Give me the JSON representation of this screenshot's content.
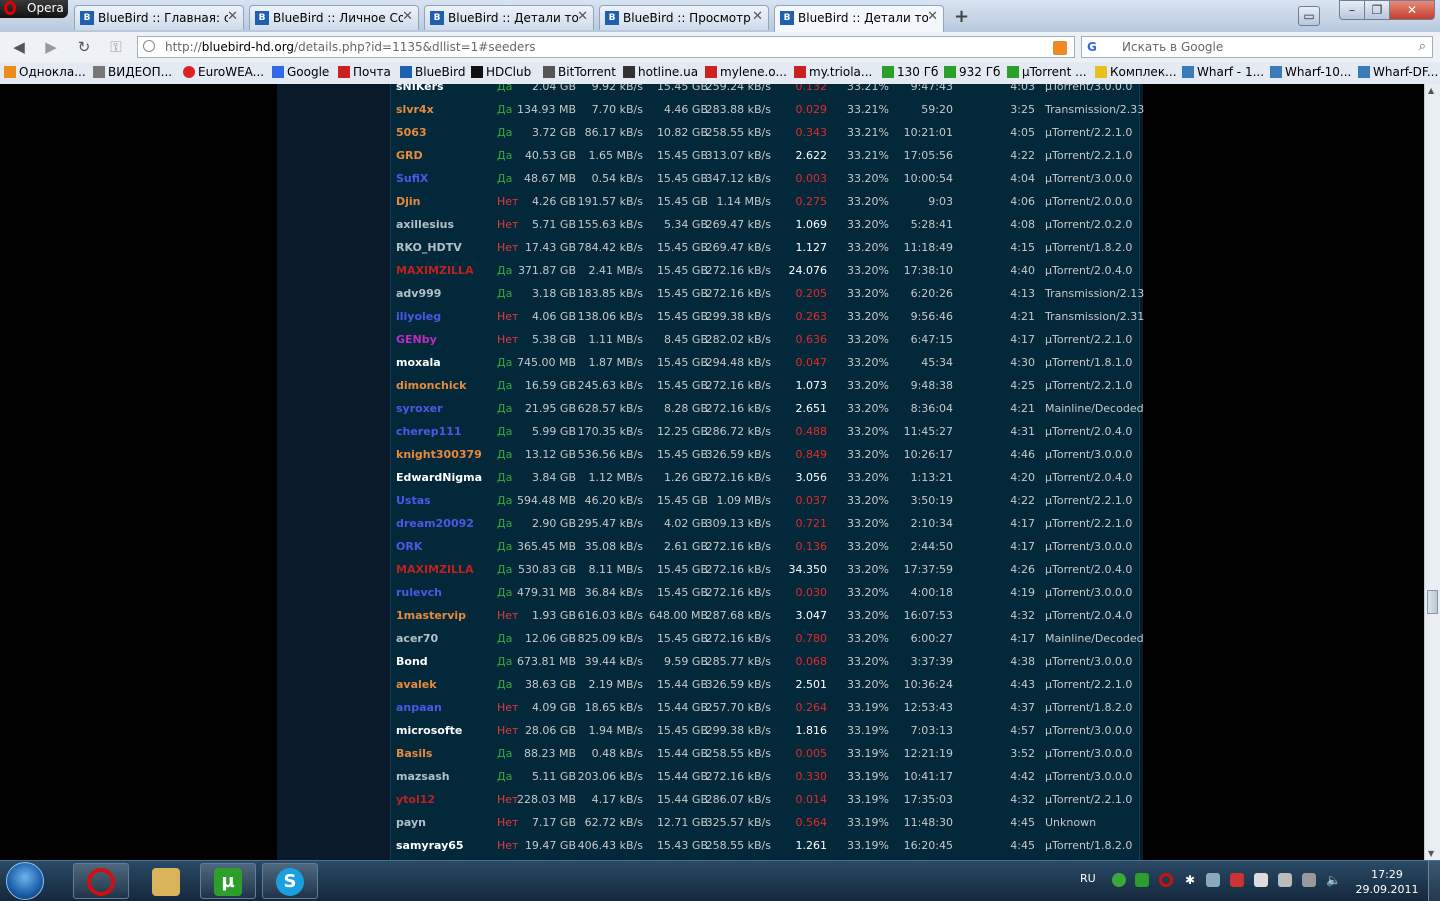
{
  "browser": {
    "menu_label": "Opera",
    "tabs": [
      {
        "title": "BlueBird :: Главная: ск..."
      },
      {
        "title": "BlueBird :: Личное Соо..."
      },
      {
        "title": "BlueBird :: Детали тор..."
      },
      {
        "title": "BlueBird :: Просмотр п..."
      },
      {
        "title": "BlueBird :: Детали тор..."
      }
    ],
    "new_tab": "+",
    "url_prefix": "http://",
    "url_host": "bluebird-hd.org",
    "url_path": "/details.php?id=1135&dllist=1#seeders",
    "search_placeholder": "Искать в Google",
    "search_engine": "G"
  },
  "bookmarks": [
    {
      "label": "Однокла..."
    },
    {
      "label": "ВИДЕОП..."
    },
    {
      "label": "EuroWEA..."
    },
    {
      "label": "Google"
    },
    {
      "label": "Почта"
    },
    {
      "label": "BlueBird"
    },
    {
      "label": "HDClub"
    },
    {
      "label": "BitTorrent"
    },
    {
      "label": "hotline.ua"
    },
    {
      "label": "mylene.o..."
    },
    {
      "label": "my.triola..."
    },
    {
      "label": "130 Гб"
    },
    {
      "label": "932 Гб"
    },
    {
      "label": "µTorrent ..."
    },
    {
      "label": "Комплек..."
    },
    {
      "label": "Wharf - 1..."
    },
    {
      "label": "Wharf-10..."
    },
    {
      "label": "Wharf-DF..."
    }
  ],
  "colors": {
    "page_bg": "#000000",
    "table_bg": "#02283a",
    "yes": "#3aa83a",
    "no": "#e23a3a",
    "ratio_good": "#ffffff",
    "ratio_bad": "#e22a2a",
    "user_orange": "#e88a3c",
    "user_blue": "#4d57e6",
    "user_white": "#ffffff",
    "user_gray": "#b4c0c8",
    "user_red": "#c0201e",
    "user_magenta": "#c02ac0"
  },
  "peers": [
    {
      "name": "sNIKers",
      "cls": "white",
      "conn": "Да",
      "up": "2.04 GB",
      "us": "9.92 kB/s",
      "dl": "15.45 GB",
      "ds": "259.24 kB/s",
      "ratio": "0.132",
      "bad": true,
      "pct": "33.21%",
      "time": "9:47:43",
      "idle": "4:03",
      "client": "µTorrent/3.0.0.0"
    },
    {
      "name": "slvr4x",
      "cls": "orange",
      "conn": "Да",
      "up": "134.93 MB",
      "us": "7.70 kB/s",
      "dl": "4.46 GB",
      "ds": "283.88 kB/s",
      "ratio": "0.029",
      "bad": true,
      "pct": "33.21%",
      "time": "59:20",
      "idle": "3:25",
      "client": "Transmission/2.33"
    },
    {
      "name": "5063",
      "cls": "orange",
      "conn": "Да",
      "up": "3.72 GB",
      "us": "86.17 kB/s",
      "dl": "10.82 GB",
      "ds": "258.55 kB/s",
      "ratio": "0.343",
      "bad": true,
      "pct": "33.21%",
      "time": "10:21:01",
      "idle": "4:05",
      "client": "µTorrent/2.2.1.0"
    },
    {
      "name": "GRD",
      "cls": "orange",
      "conn": "Да",
      "up": "40.53 GB",
      "us": "1.65 MB/s",
      "dl": "15.45 GB",
      "ds": "313.07 kB/s",
      "ratio": "2.622",
      "bad": false,
      "pct": "33.21%",
      "time": "17:05:56",
      "idle": "4:22",
      "client": "µTorrent/2.2.1.0"
    },
    {
      "name": "SufiX",
      "cls": "blue",
      "conn": "Да",
      "up": "48.67 MB",
      "us": "0.54 kB/s",
      "dl": "15.45 GB",
      "ds": "347.12 kB/s",
      "ratio": "0.003",
      "bad": true,
      "pct": "33.20%",
      "time": "10:00:54",
      "idle": "4:04",
      "client": "µTorrent/3.0.0.0"
    },
    {
      "name": "Djin",
      "cls": "orange",
      "conn": "Нет",
      "up": "4.26 GB",
      "us": "191.57 kB/s",
      "dl": "15.45 GB",
      "ds": "1.14 MB/s",
      "ratio": "0.275",
      "bad": true,
      "pct": "33.20%",
      "time": "9:03",
      "idle": "4:06",
      "client": "µTorrent/2.0.0.0"
    },
    {
      "name": "axillesius",
      "cls": "gray",
      "conn": "Нет",
      "up": "5.71 GB",
      "us": "155.63 kB/s",
      "dl": "5.34 GB",
      "ds": "269.47 kB/s",
      "ratio": "1.069",
      "bad": false,
      "pct": "33.20%",
      "time": "5:28:41",
      "idle": "4:08",
      "client": "µTorrent/2.0.2.0"
    },
    {
      "name": "RKO_HDTV",
      "cls": "gray",
      "conn": "Нет",
      "up": "17.43 GB",
      "us": "784.42 kB/s",
      "dl": "15.45 GB",
      "ds": "269.47 kB/s",
      "ratio": "1.127",
      "bad": false,
      "pct": "33.20%",
      "time": "11:18:49",
      "idle": "4:15",
      "client": "µTorrent/1.8.2.0"
    },
    {
      "name": "MAXIMZILLA",
      "cls": "red",
      "conn": "Да",
      "up": "371.87 GB",
      "us": "2.41 MB/s",
      "dl": "15.45 GB",
      "ds": "272.16 kB/s",
      "ratio": "24.076",
      "bad": false,
      "pct": "33.20%",
      "time": "17:38:10",
      "idle": "4:40",
      "client": "µTorrent/2.0.4.0"
    },
    {
      "name": "adv999",
      "cls": "gray",
      "conn": "Да",
      "up": "3.18 GB",
      "us": "183.85 kB/s",
      "dl": "15.45 GB",
      "ds": "272.16 kB/s",
      "ratio": "0.205",
      "bad": true,
      "pct": "33.20%",
      "time": "6:20:26",
      "idle": "4:13",
      "client": "Transmission/2.13"
    },
    {
      "name": "iliyoleg",
      "cls": "blue",
      "conn": "Нет",
      "up": "4.06 GB",
      "us": "138.06 kB/s",
      "dl": "15.45 GB",
      "ds": "299.38 kB/s",
      "ratio": "0.263",
      "bad": true,
      "pct": "33.20%",
      "time": "9:56:46",
      "idle": "4:21",
      "client": "Transmission/2.31"
    },
    {
      "name": "GENby",
      "cls": "magenta",
      "conn": "Нет",
      "up": "5.38 GB",
      "us": "1.11 MB/s",
      "dl": "8.45 GB",
      "ds": "282.02 kB/s",
      "ratio": "0.636",
      "bad": true,
      "pct": "33.20%",
      "time": "6:47:15",
      "idle": "4:17",
      "client": "µTorrent/2.2.1.0"
    },
    {
      "name": "moxala",
      "cls": "white",
      "conn": "Да",
      "up": "745.00 MB",
      "us": "1.87 MB/s",
      "dl": "15.45 GB",
      "ds": "294.48 kB/s",
      "ratio": "0.047",
      "bad": true,
      "pct": "33.20%",
      "time": "45:34",
      "idle": "4:30",
      "client": "µTorrent/1.8.1.0"
    },
    {
      "name": "dimonchick",
      "cls": "orange",
      "conn": "Да",
      "up": "16.59 GB",
      "us": "245.63 kB/s",
      "dl": "15.45 GB",
      "ds": "272.16 kB/s",
      "ratio": "1.073",
      "bad": false,
      "pct": "33.20%",
      "time": "9:48:38",
      "idle": "4:25",
      "client": "µTorrent/2.2.1.0"
    },
    {
      "name": "syroxer",
      "cls": "blue",
      "conn": "Да",
      "up": "21.95 GB",
      "us": "628.57 kB/s",
      "dl": "8.28 GB",
      "ds": "272.16 kB/s",
      "ratio": "2.651",
      "bad": false,
      "pct": "33.20%",
      "time": "8:36:04",
      "idle": "4:21",
      "client": "Mainline/Decoded"
    },
    {
      "name": "cherep111",
      "cls": "blue",
      "conn": "Да",
      "up": "5.99 GB",
      "us": "170.35 kB/s",
      "dl": "12.25 GB",
      "ds": "286.72 kB/s",
      "ratio": "0.488",
      "bad": true,
      "pct": "33.20%",
      "time": "11:45:27",
      "idle": "4:31",
      "client": "µTorrent/2.0.4.0"
    },
    {
      "name": "knight300379",
      "cls": "orange",
      "conn": "Да",
      "up": "13.12 GB",
      "us": "536.56 kB/s",
      "dl": "15.45 GB",
      "ds": "326.59 kB/s",
      "ratio": "0.849",
      "bad": true,
      "pct": "33.20%",
      "time": "10:26:17",
      "idle": "4:46",
      "client": "µTorrent/3.0.0.0"
    },
    {
      "name": "EdwardNigma",
      "cls": "white",
      "conn": "Да",
      "up": "3.84 GB",
      "us": "1.12 MB/s",
      "dl": "1.26 GB",
      "ds": "272.16 kB/s",
      "ratio": "3.056",
      "bad": false,
      "pct": "33.20%",
      "time": "1:13:21",
      "idle": "4:20",
      "client": "µTorrent/2.0.4.0"
    },
    {
      "name": "Ustas",
      "cls": "blue",
      "conn": "Да",
      "up": "594.48 MB",
      "us": "46.20 kB/s",
      "dl": "15.45 GB",
      "ds": "1.09 MB/s",
      "ratio": "0.037",
      "bad": true,
      "pct": "33.20%",
      "time": "3:50:19",
      "idle": "4:22",
      "client": "µTorrent/2.2.1.0"
    },
    {
      "name": "dream20092",
      "cls": "blue",
      "conn": "Да",
      "up": "2.90 GB",
      "us": "295.47 kB/s",
      "dl": "4.02 GB",
      "ds": "309.13 kB/s",
      "ratio": "0.721",
      "bad": true,
      "pct": "33.20%",
      "time": "2:10:34",
      "idle": "4:17",
      "client": "µTorrent/2.2.1.0"
    },
    {
      "name": "ORK",
      "cls": "blue",
      "conn": "Да",
      "up": "365.45 MB",
      "us": "35.08 kB/s",
      "dl": "2.61 GB",
      "ds": "272.16 kB/s",
      "ratio": "0.136",
      "bad": true,
      "pct": "33.20%",
      "time": "2:44:50",
      "idle": "4:17",
      "client": "µTorrent/3.0.0.0"
    },
    {
      "name": "MAXIMZILLA",
      "cls": "red",
      "conn": "Да",
      "up": "530.83 GB",
      "us": "8.11 MB/s",
      "dl": "15.45 GB",
      "ds": "272.16 kB/s",
      "ratio": "34.350",
      "bad": false,
      "pct": "33.20%",
      "time": "17:37:59",
      "idle": "4:26",
      "client": "µTorrent/2.0.4.0"
    },
    {
      "name": "rulevch",
      "cls": "blue",
      "conn": "Да",
      "up": "479.31 MB",
      "us": "36.84 kB/s",
      "dl": "15.45 GB",
      "ds": "272.16 kB/s",
      "ratio": "0.030",
      "bad": true,
      "pct": "33.20%",
      "time": "4:00:18",
      "idle": "4:19",
      "client": "µTorrent/3.0.0.0"
    },
    {
      "name": "1mastervip",
      "cls": "orange",
      "conn": "Нет",
      "up": "1.93 GB",
      "us": "616.03 kB/s",
      "dl": "648.00 MB",
      "ds": "287.68 kB/s",
      "ratio": "3.047",
      "bad": false,
      "pct": "33.20%",
      "time": "16:07:53",
      "idle": "4:32",
      "client": "µTorrent/2.0.4.0"
    },
    {
      "name": "acer70",
      "cls": "gray",
      "conn": "Да",
      "up": "12.06 GB",
      "us": "825.09 kB/s",
      "dl": "15.45 GB",
      "ds": "272.16 kB/s",
      "ratio": "0.780",
      "bad": true,
      "pct": "33.20%",
      "time": "6:00:27",
      "idle": "4:17",
      "client": "Mainline/Decoded"
    },
    {
      "name": "Bond",
      "cls": "white",
      "conn": "Да",
      "up": "673.81 MB",
      "us": "39.44 kB/s",
      "dl": "9.59 GB",
      "ds": "285.77 kB/s",
      "ratio": "0.068",
      "bad": true,
      "pct": "33.20%",
      "time": "3:37:39",
      "idle": "4:38",
      "client": "µTorrent/3.0.0.0"
    },
    {
      "name": "avalek",
      "cls": "orange",
      "conn": "Да",
      "up": "38.63 GB",
      "us": "2.19 MB/s",
      "dl": "15.44 GB",
      "ds": "326.59 kB/s",
      "ratio": "2.501",
      "bad": false,
      "pct": "33.20%",
      "time": "10:36:24",
      "idle": "4:43",
      "client": "µTorrent/2.2.1.0"
    },
    {
      "name": "anpaan",
      "cls": "blue",
      "conn": "Нет",
      "up": "4.09 GB",
      "us": "18.65 kB/s",
      "dl": "15.44 GB",
      "ds": "257.70 kB/s",
      "ratio": "0.264",
      "bad": true,
      "pct": "33.19%",
      "time": "12:53:43",
      "idle": "4:37",
      "client": "µTorrent/1.8.2.0"
    },
    {
      "name": "microsofte",
      "cls": "white",
      "conn": "Нет",
      "up": "28.06 GB",
      "us": "1.94 MB/s",
      "dl": "15.45 GB",
      "ds": "299.38 kB/s",
      "ratio": "1.816",
      "bad": false,
      "pct": "33.19%",
      "time": "7:03:13",
      "idle": "4:57",
      "client": "µTorrent/3.0.0.0"
    },
    {
      "name": "Basils",
      "cls": "orange",
      "conn": "Да",
      "up": "88.23 MB",
      "us": "0.48 kB/s",
      "dl": "15.44 GB",
      "ds": "258.55 kB/s",
      "ratio": "0.005",
      "bad": true,
      "pct": "33.19%",
      "time": "12:21:19",
      "idle": "3:52",
      "client": "µTorrent/3.0.0.0"
    },
    {
      "name": "mazsash",
      "cls": "gray",
      "conn": "Да",
      "up": "5.11 GB",
      "us": "203.06 kB/s",
      "dl": "15.44 GB",
      "ds": "272.16 kB/s",
      "ratio": "0.330",
      "bad": true,
      "pct": "33.19%",
      "time": "10:41:17",
      "idle": "4:42",
      "client": "µTorrent/3.0.0.0"
    },
    {
      "name": "ytol12",
      "cls": "red",
      "conn": "Нет",
      "up": "228.03 MB",
      "us": "4.17 kB/s",
      "dl": "15.44 GB",
      "ds": "286.07 kB/s",
      "ratio": "0.014",
      "bad": true,
      "pct": "33.19%",
      "time": "17:35:03",
      "idle": "4:32",
      "client": "µTorrent/2.2.1.0"
    },
    {
      "name": "payn",
      "cls": "gray",
      "conn": "Нет",
      "up": "7.17 GB",
      "us": "62.72 kB/s",
      "dl": "12.71 GB",
      "ds": "325.57 kB/s",
      "ratio": "0.564",
      "bad": true,
      "pct": "33.19%",
      "time": "11:48:30",
      "idle": "4:45",
      "client": "Unknown"
    },
    {
      "name": "samyray65",
      "cls": "white",
      "conn": "Нет",
      "up": "19.47 GB",
      "us": "406.43 kB/s",
      "dl": "15.43 GB",
      "ds": "258.55 kB/s",
      "ratio": "1.261",
      "bad": false,
      "pct": "33.19%",
      "time": "16:20:45",
      "idle": "4:45",
      "client": "µTorrent/1.8.2.0"
    }
  ],
  "taskbar": {
    "lang": "RU",
    "time": "17:29",
    "date": "29.09.2011",
    "apps": [
      {
        "icon": "opera-icon",
        "glyph": "O",
        "color": "#cc1111"
      },
      {
        "icon": "explorer-icon",
        "glyph": "",
        "color": "#d9b35a"
      },
      {
        "icon": "utorrent-icon",
        "glyph": "µ",
        "color": "#2c9e2c"
      },
      {
        "icon": "skype-icon",
        "glyph": "S",
        "color": "#1aa0e0"
      }
    ]
  }
}
